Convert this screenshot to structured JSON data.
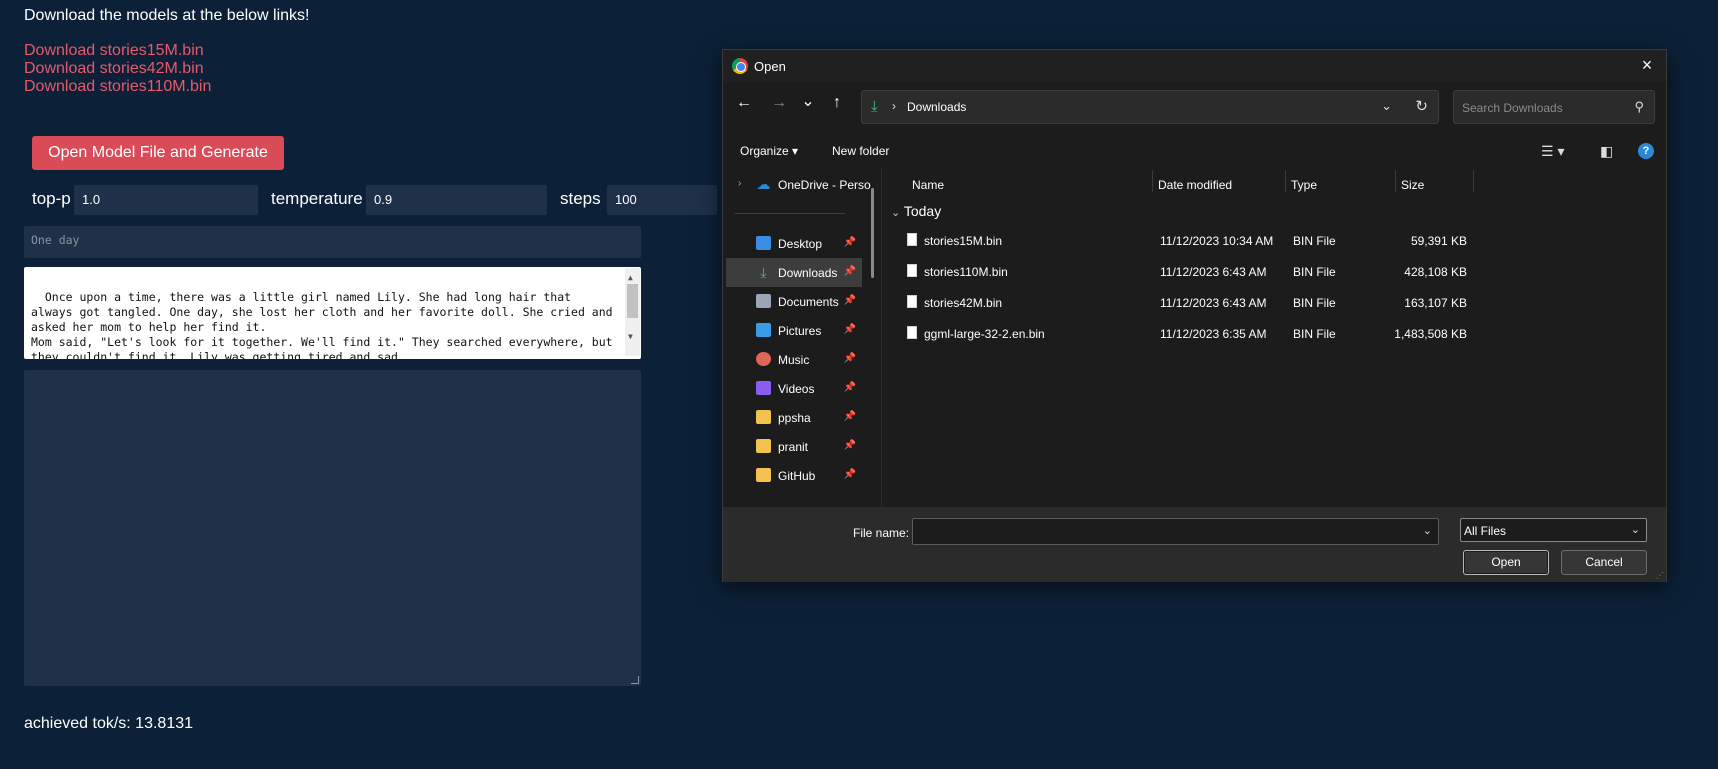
{
  "page": {
    "headline": "Download the models at the below links!",
    "links": [
      "Download stories15M.bin",
      "Download stories42M.bin",
      "Download stories110M.bin"
    ],
    "generate_button": "Open Model File and Generate",
    "params": {
      "top_p": {
        "label": "top-p",
        "value": "1.0"
      },
      "temperature": {
        "label": "temperature",
        "value": "0.9"
      },
      "steps": {
        "label": "steps",
        "value": "100"
      }
    },
    "prompt_placeholder": "One day",
    "story": "Once upon a time, there was a little girl named Lily. She had long hair that always got tangled. One day, she lost her cloth and her favorite doll. She cried and asked her mom to help her find it.\nMom said, \"Let's look for it together. We'll find it.\" They searched everywhere, but they couldn't find it. Lily was getting tired and sad.\nSuddenly, they heard a noise coming from",
    "tok_s": "achieved tok/s: 13.8131"
  },
  "dialog": {
    "title": "Open",
    "close_icon": "×",
    "nav": {
      "back": "←",
      "forward": "→",
      "recent": "⌄",
      "up": "↑"
    },
    "address": {
      "separator": "›",
      "crumb": "Downloads",
      "dropdown": "⌄",
      "refresh": "↻"
    },
    "search_placeholder": "Search Downloads",
    "search_icon": "⚲",
    "commands": {
      "organize": "Organize ▾",
      "new_folder": "New folder"
    },
    "sidebar": [
      {
        "label": "OneDrive - Perso",
        "icon": "onedrive-icon",
        "color": "#2b88d8",
        "pin": false
      },
      {
        "label": "Desktop",
        "icon": "desktop-icon",
        "color": "#3a8ee6",
        "pin": true
      },
      {
        "label": "Downloads",
        "icon": "downloads-icon",
        "color": "#3ac27d",
        "pin": true,
        "selected": true
      },
      {
        "label": "Documents",
        "icon": "documents-icon",
        "color": "#9aa6b8",
        "pin": true
      },
      {
        "label": "Pictures",
        "icon": "pictures-icon",
        "color": "#3a9be6",
        "pin": true
      },
      {
        "label": "Music",
        "icon": "music-icon",
        "color": "#e0665a",
        "pin": true
      },
      {
        "label": "Videos",
        "icon": "videos-icon",
        "color": "#8a5cf0",
        "pin": true
      },
      {
        "label": "ppsha",
        "icon": "folder-icon",
        "color": "#f2c14e",
        "pin": true
      },
      {
        "label": "pranit",
        "icon": "folder-icon",
        "color": "#f2c14e",
        "pin": true
      },
      {
        "label": "GitHub",
        "icon": "folder-icon",
        "color": "#f2c14e",
        "pin": true
      }
    ],
    "columns": {
      "name": "Name",
      "date": "Date modified",
      "type": "Type",
      "size": "Size"
    },
    "group": "Today",
    "files": [
      {
        "name": "stories15M.bin",
        "date": "11/12/2023 10:34 AM",
        "type": "BIN File",
        "size": "59,391 KB"
      },
      {
        "name": "stories110M.bin",
        "date": "11/12/2023 6:43 AM",
        "type": "BIN File",
        "size": "428,108 KB"
      },
      {
        "name": "stories42M.bin",
        "date": "11/12/2023 6:43 AM",
        "type": "BIN File",
        "size": "163,107 KB"
      },
      {
        "name": "ggml-large-32-2.en.bin",
        "date": "11/12/2023 6:35 AM",
        "type": "BIN File",
        "size": "1,483,508 KB"
      }
    ],
    "file_name_label": "File name:",
    "file_name_value": "",
    "filter": "All Files",
    "open_button": "Open",
    "cancel_button": "Cancel"
  }
}
